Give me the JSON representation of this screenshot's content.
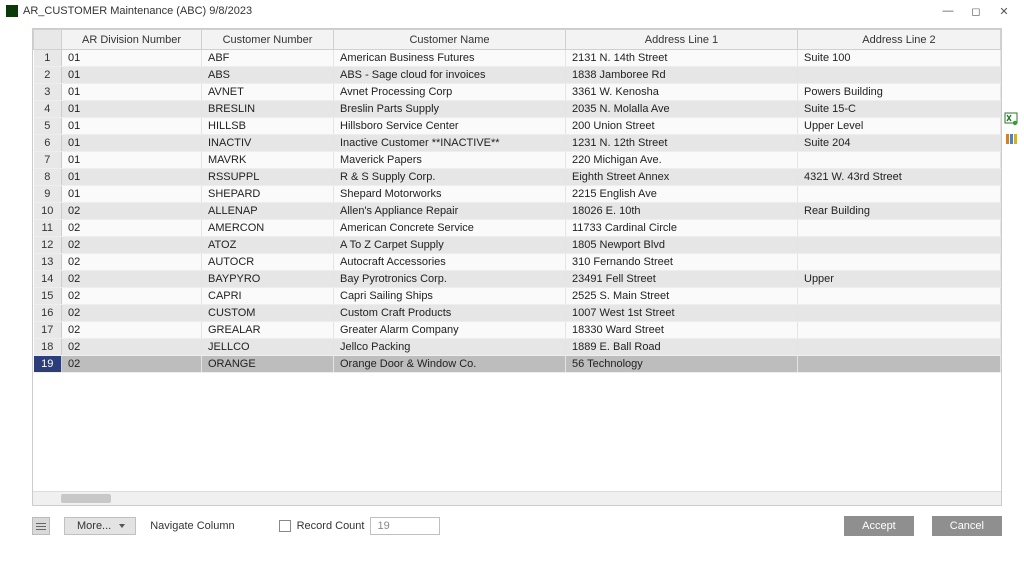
{
  "window": {
    "title": "AR_CUSTOMER Maintenance (ABC) 9/8/2023"
  },
  "columns": {
    "c1": "AR Division Number",
    "c2": "Customer Number",
    "c3": "Customer Name",
    "c4": "Address Line 1",
    "c5": "Address Line 2"
  },
  "rows": [
    {
      "n": "1",
      "div": "01",
      "cust": "ABF",
      "name": "American Business Futures",
      "a1": "2131 N. 14th Street",
      "a2": "Suite 100"
    },
    {
      "n": "2",
      "div": "01",
      "cust": "ABS",
      "name": "ABS - Sage cloud for invoices",
      "a1": "1838 Jamboree Rd",
      "a2": ""
    },
    {
      "n": "3",
      "div": "01",
      "cust": "AVNET",
      "name": "Avnet Processing Corp",
      "a1": "3361 W. Kenosha",
      "a2": "Powers Building"
    },
    {
      "n": "4",
      "div": "01",
      "cust": "BRESLIN",
      "name": "Breslin Parts Supply",
      "a1": "2035 N. Molalla Ave",
      "a2": "Suite 15-C"
    },
    {
      "n": "5",
      "div": "01",
      "cust": "HILLSB",
      "name": "Hillsboro Service Center",
      "a1": "200 Union Street",
      "a2": "Upper Level"
    },
    {
      "n": "6",
      "div": "01",
      "cust": "INACTIV",
      "name": "Inactive Customer **INACTIVE**",
      "a1": "1231 N. 12th Street",
      "a2": "Suite 204"
    },
    {
      "n": "7",
      "div": "01",
      "cust": "MAVRK",
      "name": "Maverick Papers",
      "a1": "220 Michigan Ave.",
      "a2": ""
    },
    {
      "n": "8",
      "div": "01",
      "cust": "RSSUPPL",
      "name": "R & S Supply Corp.",
      "a1": "Eighth Street Annex",
      "a2": "4321 W. 43rd Street"
    },
    {
      "n": "9",
      "div": "01",
      "cust": "SHEPARD",
      "name": "Shepard Motorworks",
      "a1": "2215 English Ave",
      "a2": ""
    },
    {
      "n": "10",
      "div": "02",
      "cust": "ALLENAP",
      "name": "Allen's Appliance Repair",
      "a1": "18026 E. 10th",
      "a2": "Rear Building"
    },
    {
      "n": "11",
      "div": "02",
      "cust": "AMERCON",
      "name": "American Concrete Service",
      "a1": "11733 Cardinal Circle",
      "a2": ""
    },
    {
      "n": "12",
      "div": "02",
      "cust": "ATOZ",
      "name": "A To Z Carpet Supply",
      "a1": "1805 Newport Blvd",
      "a2": ""
    },
    {
      "n": "13",
      "div": "02",
      "cust": "AUTOCR",
      "name": "Autocraft Accessories",
      "a1": "310 Fernando Street",
      "a2": ""
    },
    {
      "n": "14",
      "div": "02",
      "cust": "BAYPYRO",
      "name": "Bay Pyrotronics Corp.",
      "a1": "23491 Fell Street",
      "a2": "Upper"
    },
    {
      "n": "15",
      "div": "02",
      "cust": "CAPRI",
      "name": "Capri Sailing Ships",
      "a1": "2525 S. Main Street",
      "a2": ""
    },
    {
      "n": "16",
      "div": "02",
      "cust": "CUSTOM",
      "name": "Custom Craft Products",
      "a1": "1007 West 1st Street",
      "a2": ""
    },
    {
      "n": "17",
      "div": "02",
      "cust": "GREALAR",
      "name": "Greater Alarm Company",
      "a1": "18330 Ward Street",
      "a2": ""
    },
    {
      "n": "18",
      "div": "02",
      "cust": "JELLCO",
      "name": "Jellco Packing",
      "a1": "1889 E. Ball Road",
      "a2": ""
    },
    {
      "n": "19",
      "div": "02",
      "cust": "ORANGE",
      "name": "Orange Door & Window Co.",
      "a1": "56 Technology",
      "a2": ""
    }
  ],
  "selected_row_index": 18,
  "footer": {
    "more_label": "More...",
    "navigate_label": "Navigate Column",
    "record_count_label": "Record Count",
    "record_count_value": "19",
    "accept_label": "Accept",
    "cancel_label": "Cancel"
  }
}
